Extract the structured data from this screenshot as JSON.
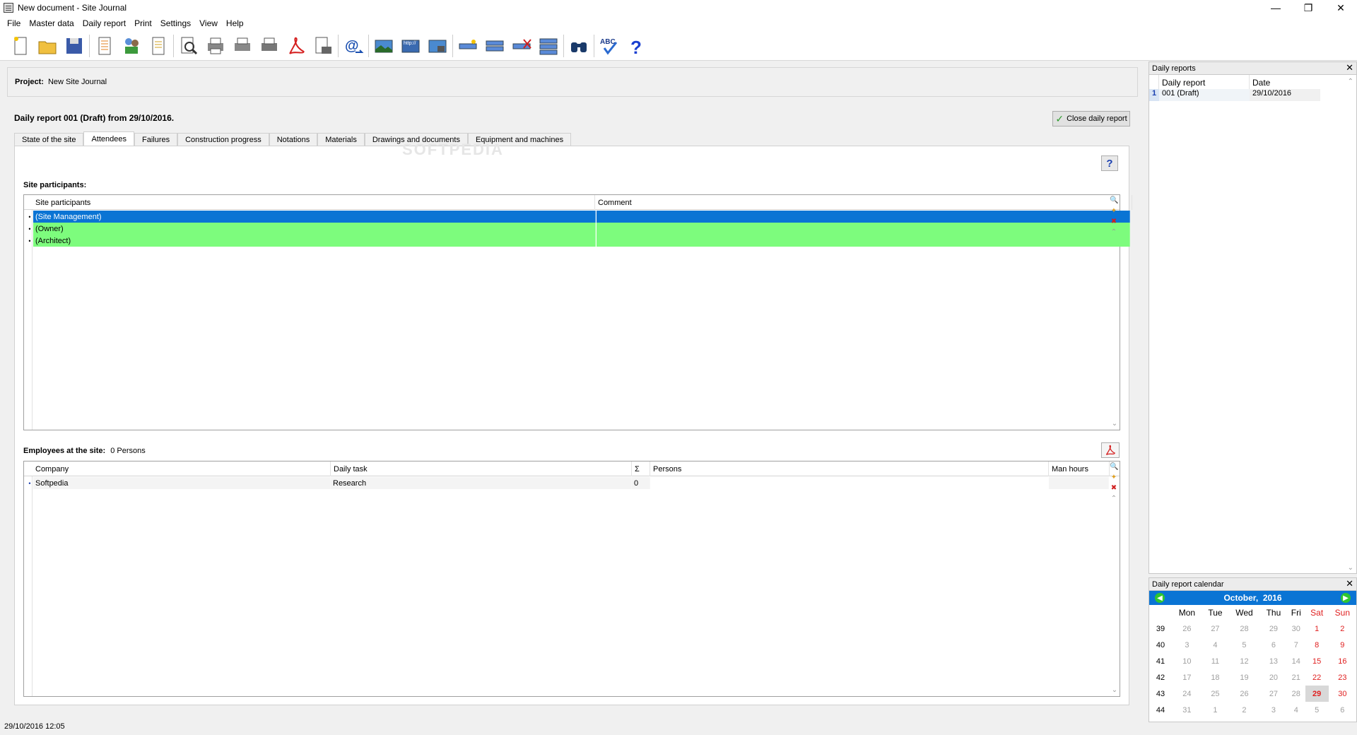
{
  "window": {
    "title": "New document - Site Journal",
    "minimize": "—",
    "restore": "❐",
    "close": "✕"
  },
  "menu": [
    "File",
    "Master data",
    "Daily report",
    "Print",
    "Settings",
    "View",
    "Help"
  ],
  "toolbar": {
    "icons": [
      "new-document-icon",
      "open-folder-icon",
      "save-icon",
      "report-list-icon",
      "users-icon",
      "notes-icon",
      "preview-icon",
      "print-icon",
      "print-all-icon",
      "print-setup-icon",
      "pdf-icon",
      "export-icon",
      "email-icon",
      "image-icon",
      "web-image-icon",
      "camera-image-icon",
      "add-row-icon",
      "insert-row-icon",
      "delete-row-icon",
      "move-row-icon",
      "search-icon",
      "spellcheck-icon",
      "help-icon"
    ]
  },
  "project": {
    "label": "Project:",
    "value": "New Site Journal"
  },
  "report": {
    "title": "Daily report 001 (Draft) from 29/10/2016.",
    "close_label": "Close daily report"
  },
  "tabs": [
    "State of the site",
    "Attendees",
    "Failures",
    "Construction progress",
    "Notations",
    "Materials",
    "Drawings and documents",
    "Equipment and machines"
  ],
  "active_tab": "Attendees",
  "watermark": "SOFTPEDIA",
  "participants": {
    "label": "Site participants:",
    "columns": [
      "Site participants",
      "Comment"
    ],
    "rows": [
      {
        "name": "(Site Management)",
        "comment": "",
        "state": "selected"
      },
      {
        "name": "(Owner)",
        "comment": "",
        "state": "green"
      },
      {
        "name": "(Architect)",
        "comment": "",
        "state": "green"
      }
    ]
  },
  "employees": {
    "label": "Employees at the site:",
    "count": "0 Persons",
    "columns": [
      "Company",
      "Daily task",
      "Σ",
      "Persons",
      "Man hours"
    ],
    "rows": [
      {
        "company": "Softpedia",
        "task": "Research",
        "sum": "0",
        "persons": "",
        "hours": ""
      }
    ]
  },
  "status": {
    "datetime": "29/10/2016 12:05"
  },
  "daily_reports": {
    "title": "Daily reports",
    "columns": [
      "Daily report",
      "Date"
    ],
    "rows": [
      {
        "index": "1",
        "report": "001 (Draft)",
        "date": "29/10/2016"
      }
    ]
  },
  "calendar": {
    "title": "Daily report calendar",
    "month": "October,",
    "year": "2016",
    "weekdays": [
      "Mon",
      "Tue",
      "Wed",
      "Thu",
      "Fri",
      "Sat",
      "Sun"
    ],
    "weeks": [
      {
        "wk": "39",
        "days": [
          "26",
          "27",
          "28",
          "29",
          "30",
          "1",
          "2"
        ]
      },
      {
        "wk": "40",
        "days": [
          "3",
          "4",
          "5",
          "6",
          "7",
          "8",
          "9"
        ]
      },
      {
        "wk": "41",
        "days": [
          "10",
          "11",
          "12",
          "13",
          "14",
          "15",
          "16"
        ]
      },
      {
        "wk": "42",
        "days": [
          "17",
          "18",
          "19",
          "20",
          "21",
          "22",
          "23"
        ]
      },
      {
        "wk": "43",
        "days": [
          "24",
          "25",
          "26",
          "27",
          "28",
          "29",
          "30"
        ]
      },
      {
        "wk": "44",
        "days": [
          "31",
          "1",
          "2",
          "3",
          "4",
          "5",
          "6"
        ]
      }
    ],
    "today": "29"
  }
}
